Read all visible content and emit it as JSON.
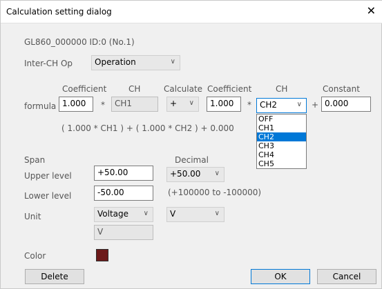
{
  "window": {
    "title": "Calculation setting dialog",
    "close_label": "✕"
  },
  "device": {
    "info": "GL860_000000 ID:0 (No.1)"
  },
  "inter_ch": {
    "label": "Inter-CH Op",
    "value": "Operation"
  },
  "formula": {
    "label": "formula",
    "headers": {
      "coefficient1": "Coefficient",
      "ch1": "CH",
      "calculate": "Calculate",
      "coefficient2": "Coefficient",
      "ch2": "CH",
      "constant": "Constant"
    },
    "coefficient1": "1.000",
    "multiply1": "*",
    "ch1": "CH1",
    "calculate": "+",
    "coefficient2": "1.000",
    "multiply2": "*",
    "ch2": "CH2",
    "plus": "+",
    "constant": "0.000",
    "expression": "( 1.000 * CH1 ) + ( 1.000 * CH2 ) + 0.000",
    "ch_options": [
      "OFF",
      "CH1",
      "CH2",
      "CH3",
      "CH4",
      "CH5"
    ],
    "ch_selected_index": 2
  },
  "span": {
    "label": "Span",
    "decimal_label": "Decimal",
    "upper_label": "Upper level",
    "upper_value": "+50.00",
    "decimal_value": "+50.00",
    "lower_label": "Lower level",
    "lower_value": "-50.00",
    "range_text": "(+100000 to -100000)"
  },
  "unit": {
    "label": "Unit",
    "type_value": "Voltage",
    "unit_value": "V",
    "custom_value": "V"
  },
  "color": {
    "label": "Color",
    "swatch": "#6d1a1a"
  },
  "buttons": {
    "delete": "Delete",
    "ok": "OK",
    "cancel": "Cancel"
  }
}
